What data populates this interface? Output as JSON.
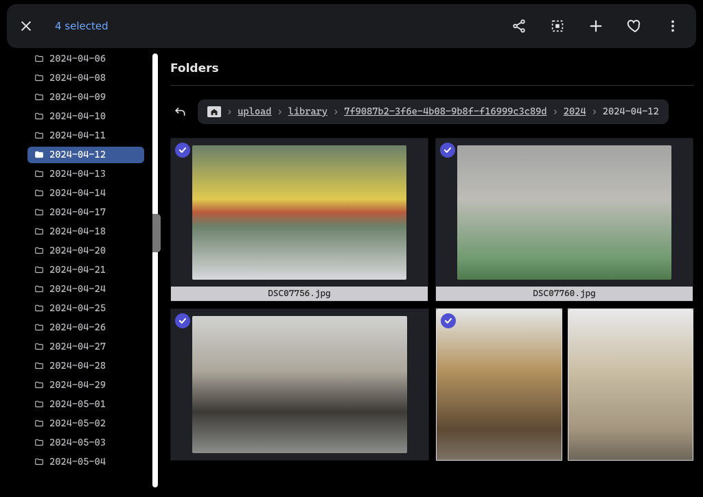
{
  "topbar": {
    "selection_label": "4 selected",
    "icons": {
      "close": "close-icon",
      "share": "share-icon",
      "select": "select-all-icon",
      "add": "plus-icon",
      "favorite": "heart-icon",
      "more": "more-vertical-icon"
    }
  },
  "sidebar": {
    "selected": "2024-04-12",
    "folders": [
      "2024-04-06",
      "2024-04-08",
      "2024-04-09",
      "2024-04-10",
      "2024-04-11",
      "2024-04-12",
      "2024-04-13",
      "2024-04-14",
      "2024-04-17",
      "2024-04-18",
      "2024-04-20",
      "2024-04-21",
      "2024-04-24",
      "2024-04-25",
      "2024-04-26",
      "2024-04-27",
      "2024-04-28",
      "2024-04-29",
      "2024-05-01",
      "2024-05-02",
      "2024-05-03",
      "2024-05-04"
    ]
  },
  "main": {
    "section_title": "Folders",
    "breadcrumb": {
      "home_icon": "home-icon",
      "back_icon": "up-left-arrow-icon",
      "segments": [
        "upload",
        "library",
        "7f9087b2-3f6e-4b08-9b8f-f16999c3c89d",
        "2024",
        "2024-04-12"
      ]
    },
    "photos_row1": [
      {
        "filename": "DSC07756.jpg",
        "selected": true
      },
      {
        "filename": "DSC07760.jpg",
        "selected": true
      }
    ],
    "photos_row2": {
      "left": {
        "selected": true
      },
      "right_pair": [
        {
          "selected": true
        },
        {
          "selected": false
        }
      ]
    }
  }
}
